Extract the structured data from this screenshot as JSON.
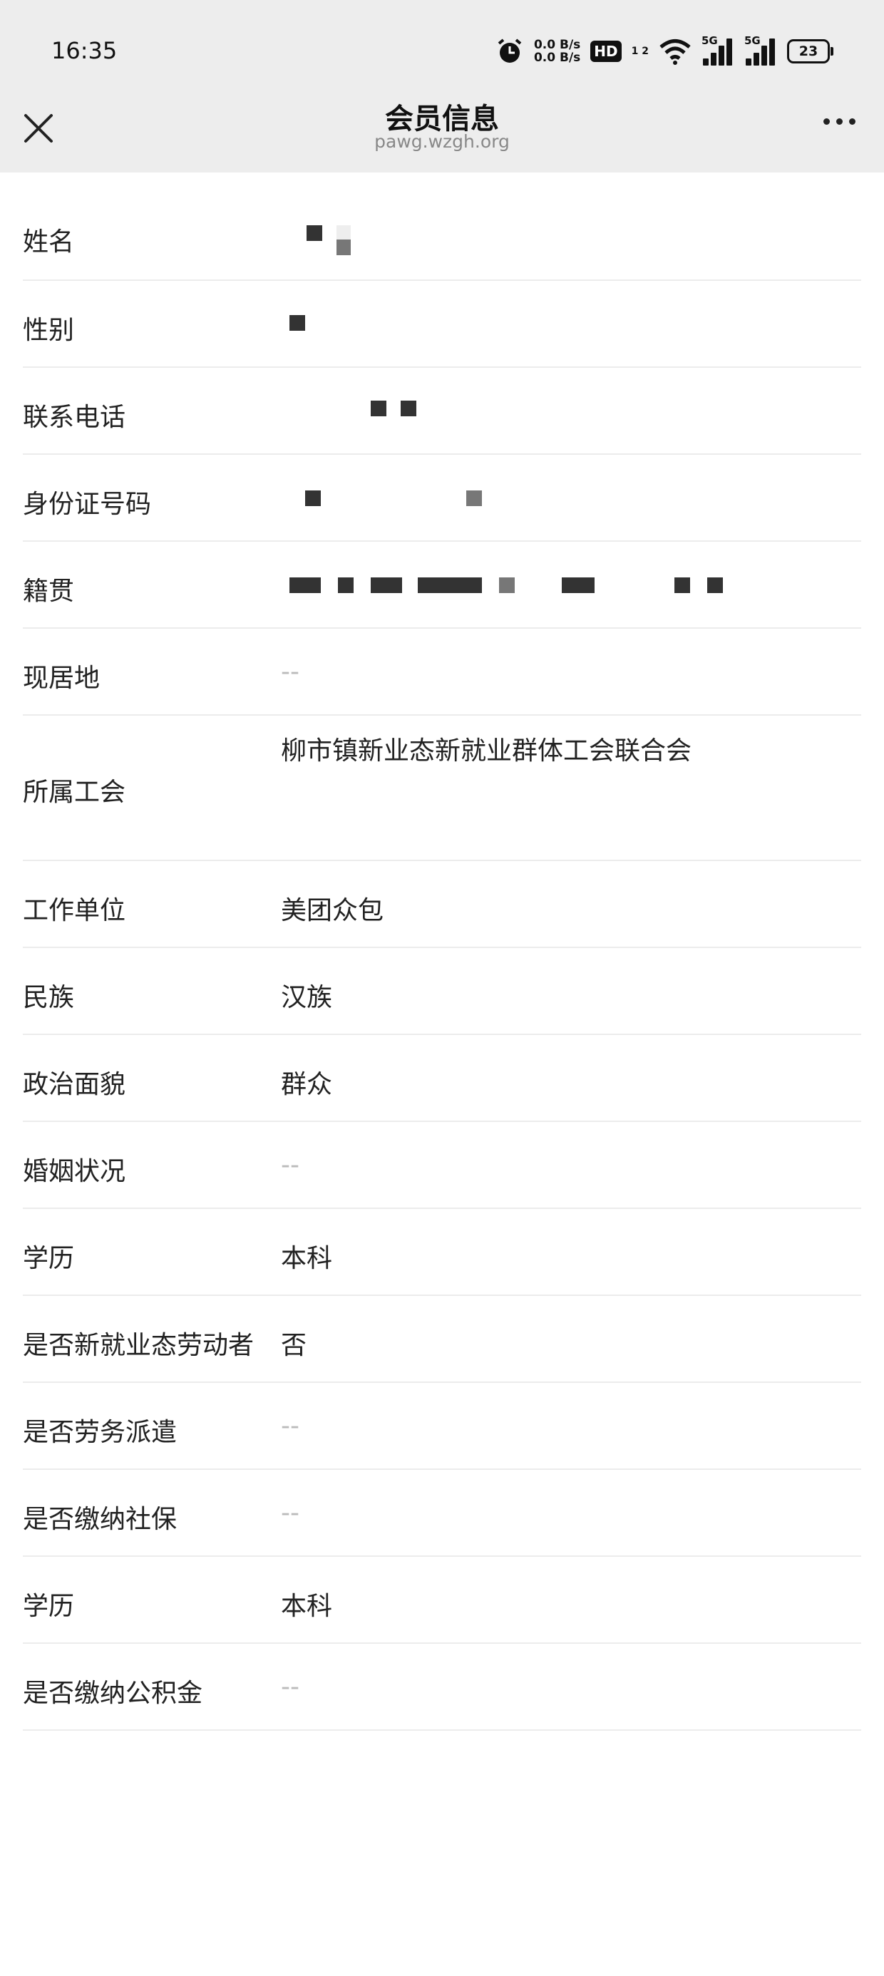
{
  "status_bar": {
    "time": "16:35",
    "net_speed_up": "0.0 B/s",
    "net_speed_down": "0.0 B/s",
    "hd_label": "HD",
    "hd_sub": "1 2",
    "sig1_label": "5G",
    "sig2_label": "5G",
    "battery": "23",
    "icons": [
      "alarm-icon",
      "wifi-icon",
      "signal-icon",
      "battery-icon"
    ]
  },
  "nav": {
    "title": "会员信息",
    "subtitle": "pawg.wzgh.org",
    "icons": [
      "close-icon",
      "more-icon"
    ]
  },
  "rows": [
    {
      "label": "姓名",
      "value": ""
    },
    {
      "label": "性别",
      "value": ""
    },
    {
      "label": "联系电话",
      "value": ""
    },
    {
      "label": "身份证号码",
      "value": ""
    },
    {
      "label": "籍贯",
      "value": ""
    },
    {
      "label": "现居地",
      "value": "--"
    },
    {
      "label": "所属工会",
      "value": "柳市镇新业态新就业群体工会联合会"
    },
    {
      "label": "工作单位",
      "value": "美团众包"
    },
    {
      "label": "民族",
      "value": "汉族"
    },
    {
      "label": "政治面貌",
      "value": "群众"
    },
    {
      "label": "婚姻状况",
      "value": "--"
    },
    {
      "label": "学历",
      "value": "本科"
    },
    {
      "label": "是否新就业态劳动者",
      "value": "否"
    },
    {
      "label": "是否劳务派遣",
      "value": "--"
    },
    {
      "label": "是否缴纳社保",
      "value": "--"
    },
    {
      "label": "学历",
      "value": "本科"
    },
    {
      "label": "是否缴纳公积金",
      "value": "--"
    }
  ],
  "colors": {
    "header_bg": "#ededed",
    "text": "#222222",
    "placeholder": "#bbbbbb",
    "divider": "#ececec"
  }
}
